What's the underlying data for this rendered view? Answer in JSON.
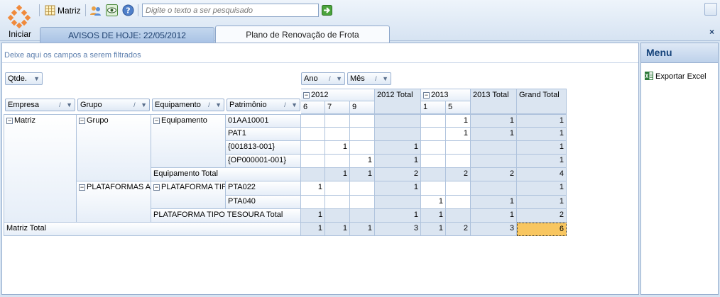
{
  "toolbar": {
    "start_label": "Iniciar",
    "matriz_label": "Matriz",
    "search_placeholder": "Digite o texto a ser pesquisado",
    "icons": [
      "start-logo-icon",
      "grid-icon",
      "users-icon",
      "eye-icon",
      "help-icon",
      "go-arrow-icon"
    ]
  },
  "tabs": [
    {
      "label": "AVISOS DE HOJE: 22/05/2012",
      "active": false
    },
    {
      "label": "Plano de Renovação de Frota",
      "active": true
    }
  ],
  "close_label": "×",
  "filter_area": {
    "hint": "Deixe aqui os campos a serem filtrados"
  },
  "data_field": "Qtde.",
  "column_fields": [
    "Ano",
    "Mês"
  ],
  "row_fields": [
    "Empresa",
    "Grupo",
    "Equipamento",
    "Patrimônio"
  ],
  "col_headers": {
    "year_2012": "2012",
    "year_2013": "2013",
    "total_2012": "2012 Total",
    "total_2013": "2013 Total",
    "grand_total": "Grand Total",
    "months_2012": [
      "6",
      "7",
      "9"
    ],
    "months_2013": [
      "1",
      "5"
    ]
  },
  "row_headers": {
    "empresa": "Matriz",
    "grupo1": "Grupo",
    "grupo2": "PLATAFORMAS AÉREAS",
    "equip1": "Equipamento",
    "equip1_total": "Equipamento Total",
    "equip2": "PLATAFORMA TIPO TESOURA",
    "equip2_total": "PLATAFORMA TIPO TESOURA Total",
    "matriz_total": "Matriz Total",
    "patrimonios": [
      "01AA10001",
      "PAT1",
      "{001813-001}",
      "{OP000001-001}",
      "PTA022",
      "PTA040"
    ]
  },
  "values": {
    "r0": [
      "",
      "",
      "",
      "",
      "",
      "1",
      "1",
      "1"
    ],
    "r1": [
      "",
      "",
      "",
      "",
      "",
      "1",
      "1",
      "1"
    ],
    "r2": [
      "",
      "1",
      "",
      "1",
      "",
      "",
      "",
      "1"
    ],
    "r3": [
      "",
      "",
      "1",
      "1",
      "",
      "",
      "",
      "1"
    ],
    "equip_total": [
      "",
      "1",
      "1",
      "2",
      "",
      "2",
      "2",
      "4"
    ],
    "r4": [
      "1",
      "",
      "",
      "1",
      "",
      "",
      "",
      "1"
    ],
    "r5": [
      "",
      "",
      "",
      "",
      "1",
      "",
      "1",
      "1"
    ],
    "plat_total": [
      "1",
      "",
      "",
      "1",
      "1",
      "",
      "1",
      "2"
    ],
    "matriz_total": [
      "1",
      "1",
      "1",
      "3",
      "1",
      "2",
      "3",
      "6"
    ]
  },
  "menu": {
    "title": "Menu",
    "items": [
      {
        "label": "Exportar Excel",
        "icon": "excel-icon"
      }
    ]
  }
}
